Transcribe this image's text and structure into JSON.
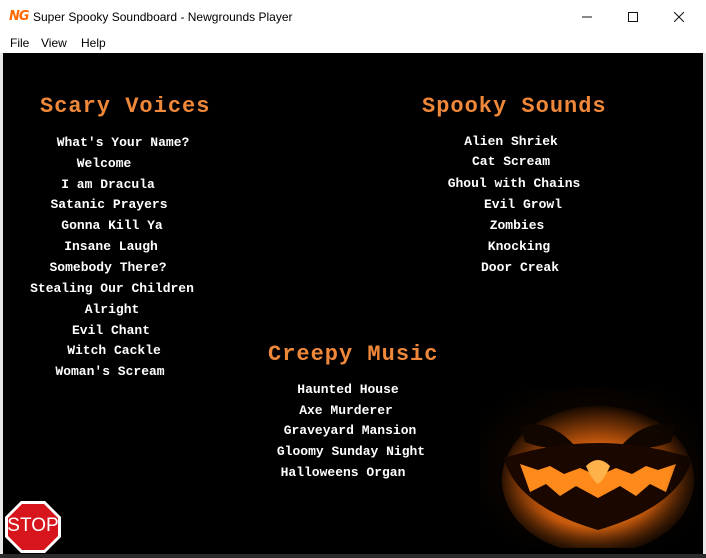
{
  "window": {
    "app_icon_text": "NG",
    "title": "Super Spooky Soundboard - Newgrounds Player"
  },
  "menu": [
    "File",
    "View",
    "Help"
  ],
  "sections": {
    "scary_voices": {
      "heading": "Scary Voices",
      "items": [
        "What's Your Name?",
        "Welcome",
        "I am Dracula",
        "Satanic Prayers",
        "Gonna Kill Ya",
        "Insane Laugh",
        "Somebody There?",
        "Stealing Our Children",
        "Alright",
        "Evil Chant",
        "Witch Cackle",
        "Woman's Scream"
      ]
    },
    "spooky_sounds": {
      "heading": "Spooky Sounds",
      "items": [
        "Alien Shriek",
        "Cat Scream",
        "Ghoul with Chains",
        "Evil Growl",
        "Zombies",
        "Knocking",
        "Door Creak"
      ]
    },
    "creepy_music": {
      "heading": "Creepy Music",
      "items": [
        "Haunted House",
        "Axe Murderer",
        "Graveyard Mansion",
        "Gloomy Sunday Night",
        "Halloweens Organ"
      ]
    }
  },
  "stop_button": {
    "label": "STOP"
  },
  "colors": {
    "heading": "#f0883a",
    "text": "#ffffff",
    "background": "#000000",
    "stop": "#d6161c"
  },
  "icons": {
    "minimize": "minimize-icon",
    "maximize": "maximize-icon",
    "close": "close-icon",
    "pumpkin": "jack-o-lantern-image"
  }
}
